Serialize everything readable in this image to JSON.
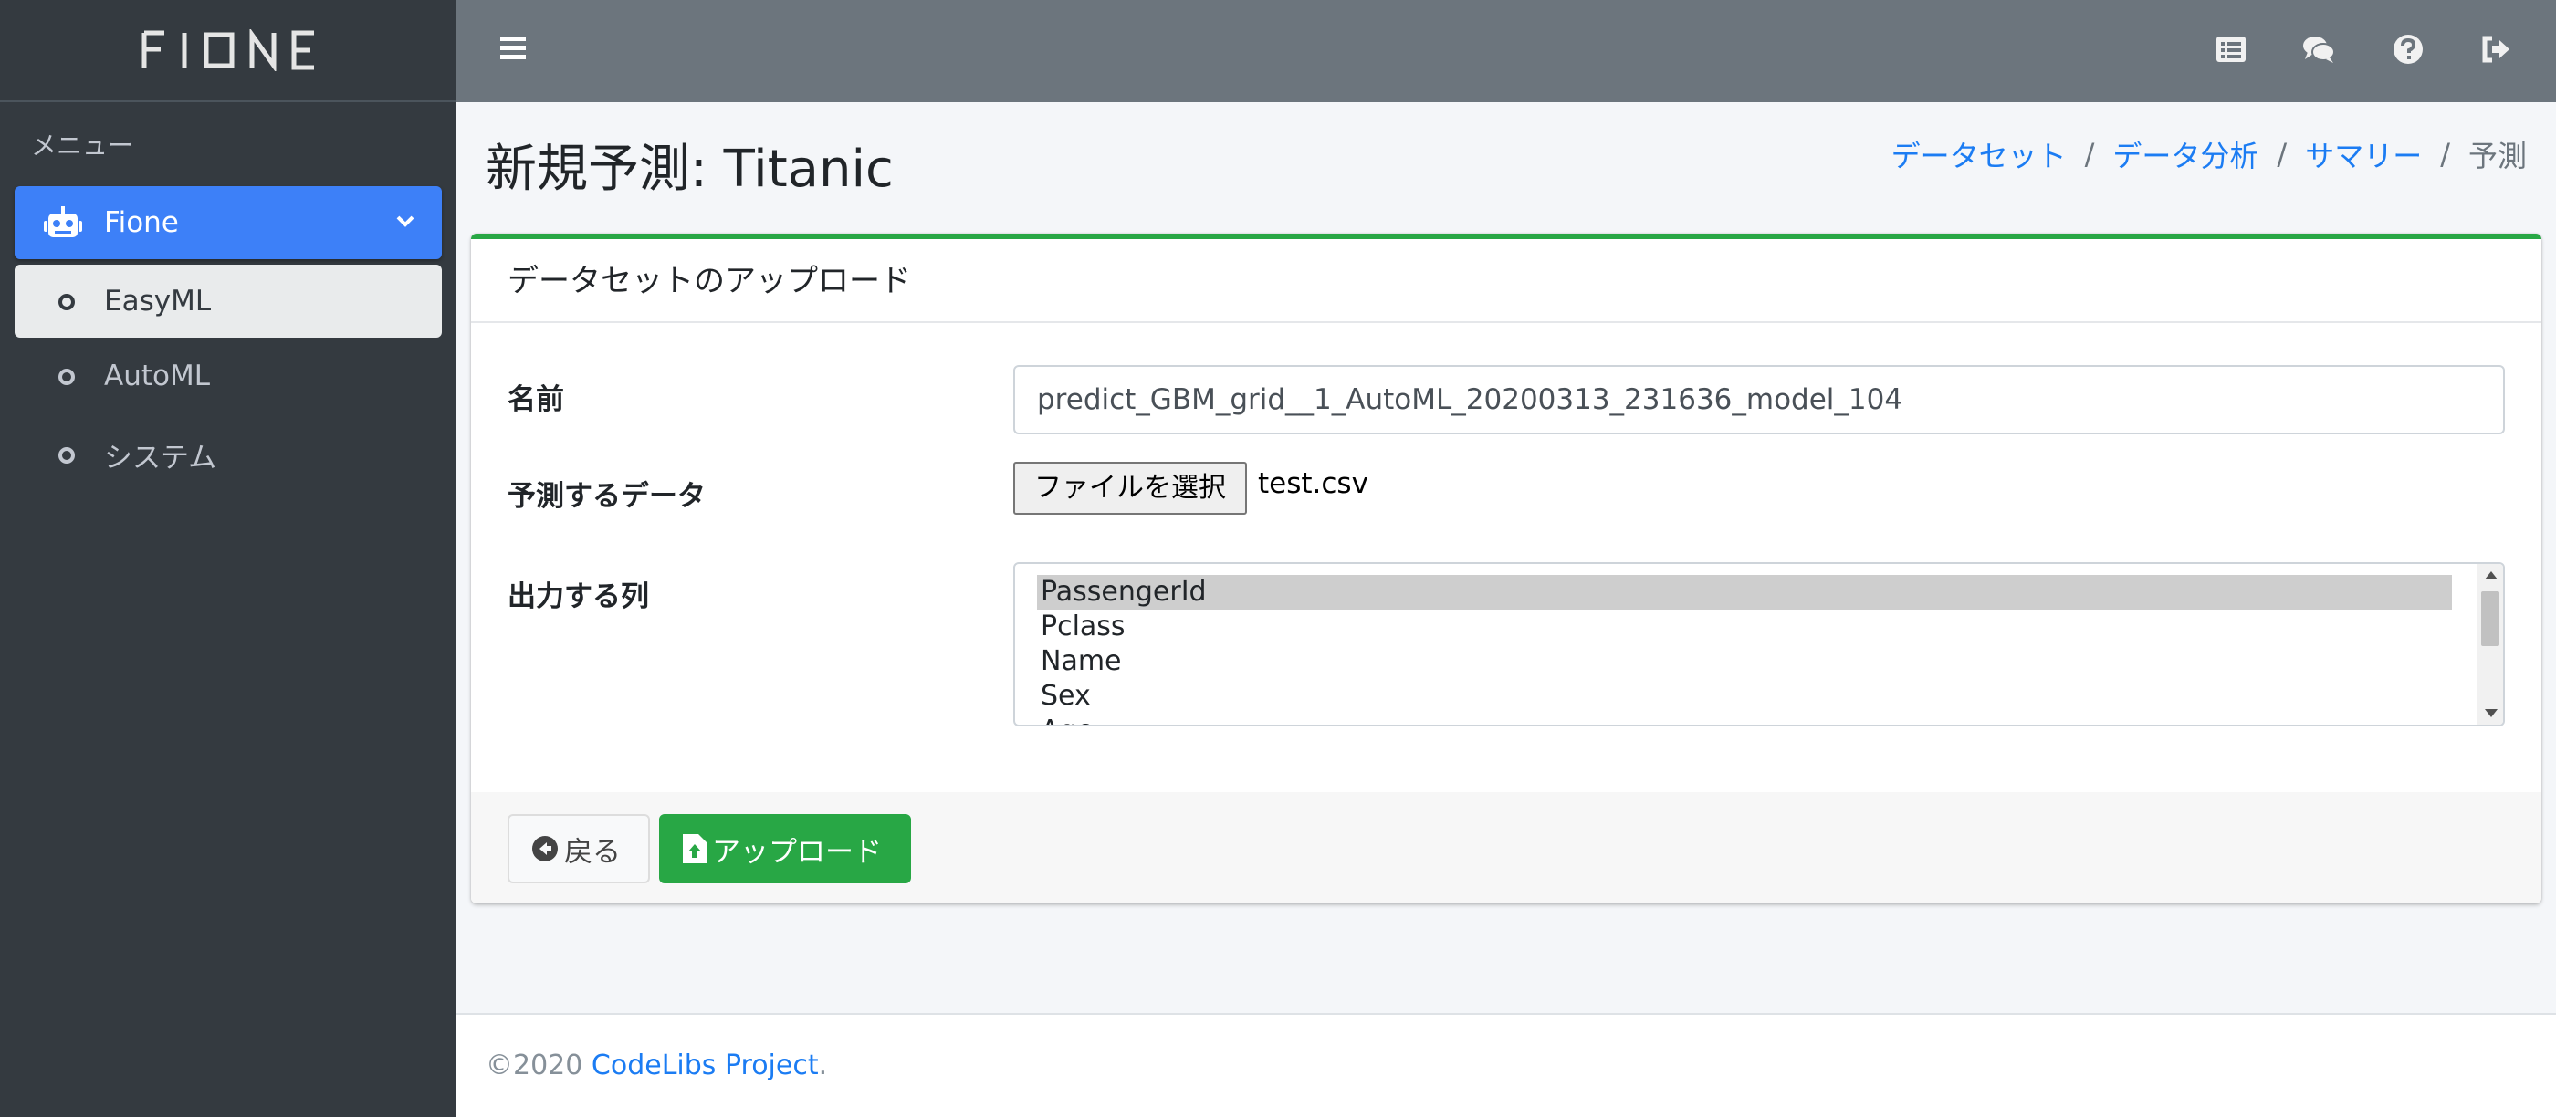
{
  "brand": {
    "logo_text": "FIONE"
  },
  "sidebar": {
    "menu_header": "メニュー",
    "items": [
      {
        "label": "Fione",
        "icon": "robot-icon"
      },
      {
        "label": "EasyML",
        "icon": "circle-icon"
      },
      {
        "label": "AutoML",
        "icon": "circle-icon"
      },
      {
        "label": "システム",
        "icon": "circle-icon"
      }
    ]
  },
  "topbar": {
    "icons": [
      "list-icon",
      "comments-icon",
      "question-circle-icon",
      "sign-out-icon"
    ]
  },
  "page": {
    "title": "新規予測: Titanic",
    "breadcrumb": [
      "データセット",
      "データ分析",
      "サマリー",
      "予測"
    ]
  },
  "card": {
    "header": "データセットのアップロード",
    "name_label": "名前",
    "name_value": "predict_GBM_grid__1_AutoML_20200313_231636_model_104",
    "data_label": "予測するデータ",
    "file_button": "ファイルを選択",
    "file_name": "test.csv",
    "columns_label": "出力する列",
    "columns": [
      "PassengerId",
      "Pclass",
      "Name",
      "Sex",
      "Age"
    ],
    "selected_column": "PassengerId",
    "back_button": "戻る",
    "upload_button": "アップロード"
  },
  "footer": {
    "copyright": "©2020 ",
    "link": "CodeLibs Project",
    "suffix": "."
  },
  "colors": {
    "sidebar_bg": "#343a40",
    "topbar_bg": "#6c757d",
    "accent": "#3d80f8",
    "success": "#28a745",
    "link": "#1b7cf3"
  }
}
